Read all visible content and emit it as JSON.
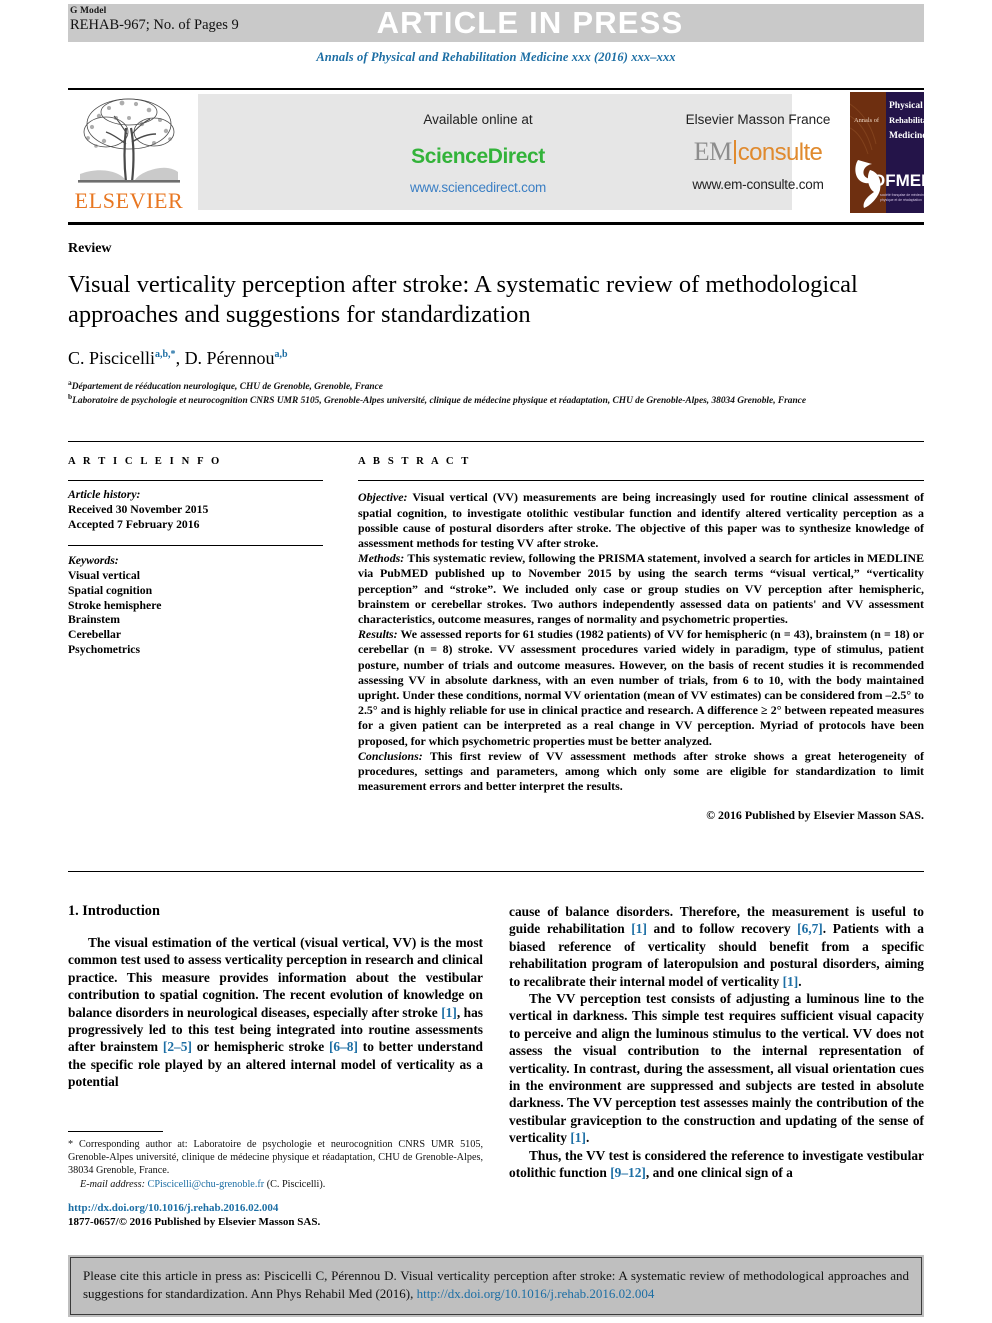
{
  "header": {
    "g_model": "G Model",
    "model_id": "REHAB-967; No. of Pages 9",
    "press_banner": "ARTICLE IN PRESS",
    "journal_line": "Annals of Physical and Rehabilitation Medicine xxx (2016) xxx–xxx"
  },
  "masthead": {
    "elsevier_wordmark": "ELSEVIER",
    "available_online": "Available online at",
    "sciencedirect_name": "ScienceDirect",
    "sciencedirect_url": "www.sciencedirect.com",
    "publisher": "Elsevier Masson France",
    "em_em": "EM",
    "em_consulte": "consulte",
    "em_url": "www.em-consulte.com",
    "sofmer": {
      "annals_of": "Annals of",
      "line1": "Physical &",
      "line2": "Rehabilitation",
      "line3": "Medicine",
      "brand": "SOFMER",
      "tagline": "société française de médecine physique et de réadaptation"
    }
  },
  "article": {
    "kind": "Review",
    "title": "Visual verticality perception after stroke: A systematic review of methodological approaches and suggestions for standardization",
    "authors": [
      {
        "name": "C. Piscicelli",
        "sup": "a,b,*"
      },
      {
        "name": "D. Pérennou",
        "sup": "a,b"
      }
    ],
    "affiliations": [
      {
        "marker": "a",
        "text": "Département de rééducation neurologique, CHU de Grenoble, Grenoble, France"
      },
      {
        "marker": "b",
        "text": "Laboratoire de psychologie et neurocognition CNRS UMR 5105, Grenoble-Alpes université, clinique de médecine physique et réadaptation, CHU de Grenoble-Alpes, 38034 Grenoble, France"
      }
    ]
  },
  "article_info": {
    "heading": "A R T I C L E  I N F O",
    "history_label": "Article history:",
    "received": "Received 30 November 2015",
    "accepted": "Accepted 7 February 2016",
    "keywords_label": "Keywords:",
    "keywords": [
      "Visual vertical",
      "Spatial cognition",
      "Stroke hemisphere",
      "Brainstem",
      "Cerebellar",
      "Psychometrics"
    ]
  },
  "abstract": {
    "heading": "A B S T R A C T",
    "objective_label": "Objective:",
    "objective_text": " Visual vertical (VV) measurements are being increasingly used for routine clinical assessment of spatial cognition, to investigate otolithic vestibular function and identify altered verticality perception as a possible cause of postural disorders after stroke. The objective of this paper was to synthesize knowledge of assessment methods for testing VV after stroke.",
    "methods_label": "Methods:",
    "methods_text": " This systematic review, following the PRISMA statement, involved a search for articles in MEDLINE via PubMED published up to November 2015 by using the search terms “visual vertical,” “verticality perception” and “stroke”. We included only case or group studies on VV perception after hemispheric, brainstem or cerebellar strokes. Two authors independently assessed data on patients' and VV assessment characteristics, outcome measures, ranges of normality and psychometric properties.",
    "results_label": "Results:",
    "results_text": " We assessed reports for 61 studies (1982 patients) of VV for hemispheric (n = 43), brainstem (n = 18) or cerebellar (n = 8) stroke. VV assessment procedures varied widely in paradigm, type of stimulus, patient posture, number of trials and outcome measures. However, on the basis of recent studies it is recommended assessing VV in absolute darkness, with an even number of trials, from 6 to 10, with the body maintained upright. Under these conditions, normal VV orientation (mean of VV estimates) can be considered from –2.5° to 2.5° and is highly reliable for use in clinical practice and research. A difference ≥ 2° between repeated measures for a given patient can be interpreted as a real change in VV perception. Myriad of protocols have been proposed, for which psychometric properties must be better analyzed.",
    "conclusions_label": "Conclusions:",
    "conclusions_text": " This first review of VV assessment methods after stroke shows a great heterogeneity of procedures, settings and parameters, among which only some are eligible for standardization to limit measurement errors and better interpret the results.",
    "copyright": "© 2016 Published by Elsevier Masson SAS."
  },
  "introduction": {
    "heading": "1. Introduction",
    "left_p1_a": "The visual estimation of the vertical (visual vertical, VV) is the most common test used to assess verticality perception in research and clinical practice. This measure provides information about the vestibular contribution to spatial cognition. The recent evolution of knowledge on balance disorders in neurological diseases, especially after stroke ",
    "left_ref1": "[1]",
    "left_p1_b": ", has progressively led to this test being integrated into routine assessments after brainstem ",
    "left_ref2": "[2–5]",
    "left_p1_c": " or hemispheric stroke ",
    "left_ref3": "[6–8]",
    "left_p1_d": " to better understand the specific role played by an altered internal model of verticality as a potential",
    "right_p1_a": "cause of balance disorders. Therefore, the measurement is useful to guide rehabilitation ",
    "right_ref1": "[1]",
    "right_p1_b": " and to follow recovery ",
    "right_ref2": "[6,7]",
    "right_p1_c": ". Patients with a biased reference of verticality should benefit from a specific rehabilitation program of lateropulsion and postural disorders, aiming to recalibrate their internal model of verticality ",
    "right_ref3": "[1]",
    "right_p1_d": ".",
    "right_p2_a": "The VV perception test consists of adjusting a luminous line to the vertical in darkness. This simple test requires sufficient visual capacity to perceive and align the luminous stimulus to the vertical. VV does not assess the visual contribution to the internal representation of verticality. In contrast, during the assessment, all visual orientation cues in the environment are suppressed and subjects are tested in absolute darkness. The VV perception test assesses mainly the contribution of the vestibular graviception to the construction and updating of the sense of verticality ",
    "right_ref4": "[1]",
    "right_p2_b": ".",
    "right_p3_a": "Thus, the VV test is considered the reference to investigate vestibular otolithic function ",
    "right_ref5": "[9–12]",
    "right_p3_b": ", and one clinical sign of a"
  },
  "footnote": {
    "marker": "*",
    "corresponding": " Corresponding author at: Laboratoire de psychologie et neurocognition CNRS UMR 5105, Grenoble-Alpes université, clinique de médecine physique et réadaptation, CHU de Grenoble-Alpes, 38034 Grenoble, France.",
    "email_label": "E-mail address:",
    "email": "CPiscicelli@chu-grenoble.fr",
    "email_suffix": " (C. Piscicelli).",
    "doi_url": "http://dx.doi.org/10.1016/j.rehab.2016.02.004",
    "issn_line": "1877-0657/© 2016 Published by Elsevier Masson SAS."
  },
  "cite_box": {
    "text_a": "Please cite this article in press as: Piscicelli  C, Pérennou  D. Visual verticality perception after stroke: A systematic review of methodological approaches and suggestions for standardization. Ann Phys Rehabil Med (2016), ",
    "link": "http://dx.doi.org/10.1016/j.rehab.2016.02.004"
  },
  "colors": {
    "journal_blue": "#1c6ea4",
    "sciencedirect_green": "#33b33a",
    "elsevier_orange": "#e87722",
    "em_orange": "#e08a2e",
    "band_gray": "#c9c9c9",
    "banner_gray": "#e6e6e6",
    "cite_gray": "#bfbfbf"
  }
}
